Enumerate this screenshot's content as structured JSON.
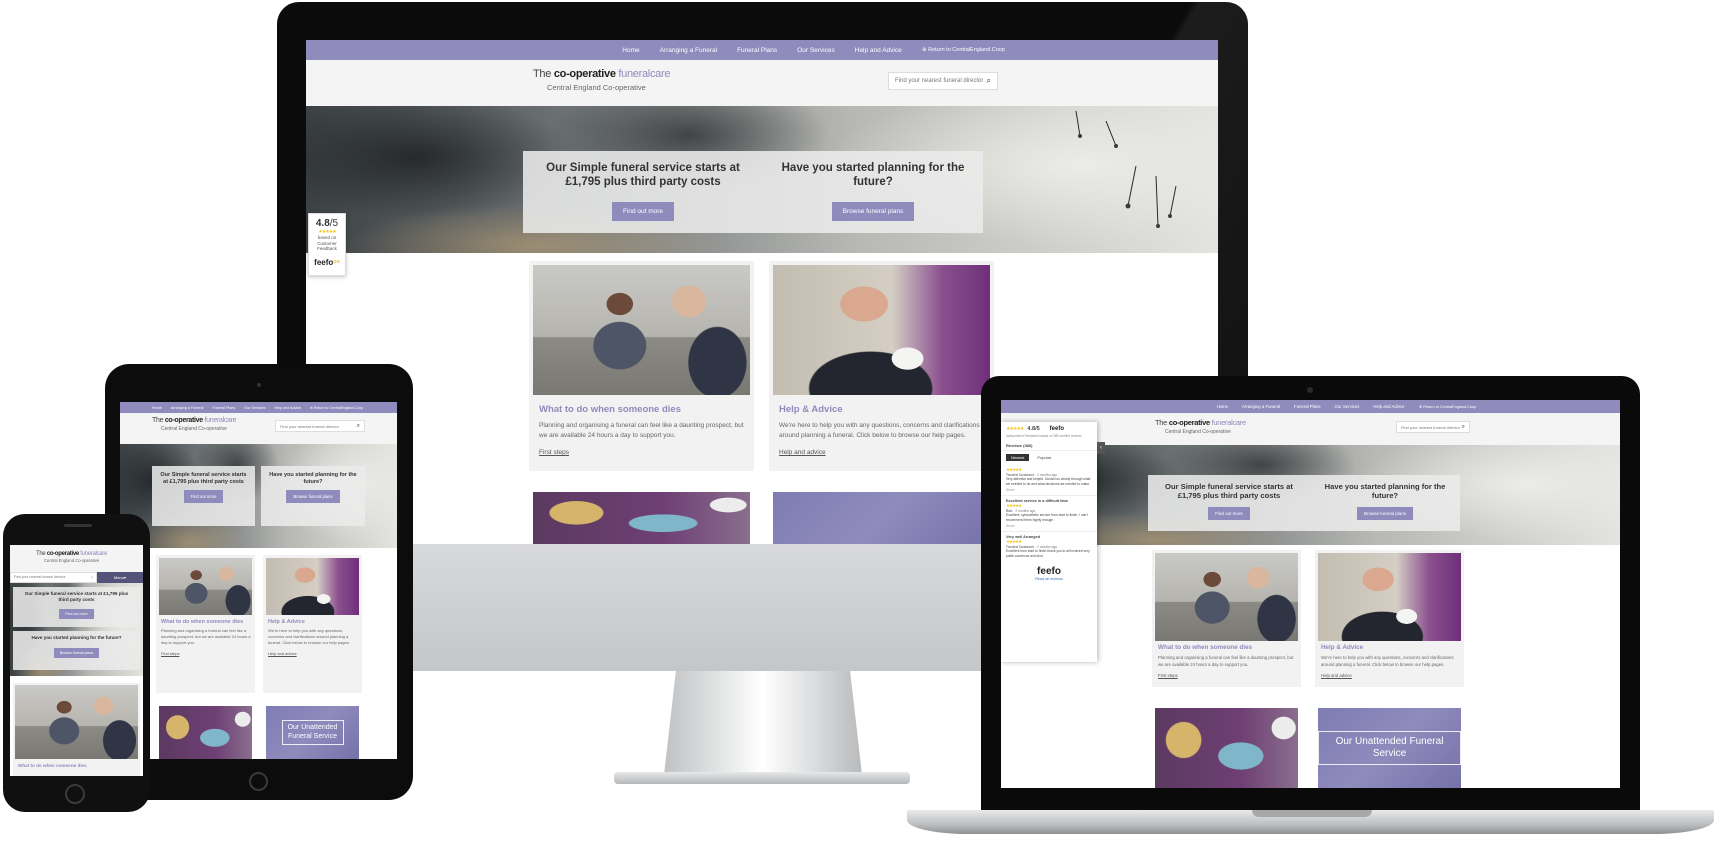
{
  "site": {
    "nav": [
      "Home",
      "Arranging a Funeral",
      "Funeral Plans",
      "Our Services",
      "Help and Advice"
    ],
    "return_prefix": "Return to",
    "return_link": "CentralEngland.Coop",
    "logo": {
      "the": "The",
      "coop": "co-operative",
      "brand": "funeralcare",
      "sub": "Central England Co-operative"
    },
    "search_placeholder": "Find your nearest funeral director",
    "menu_label": "Menu",
    "hero": {
      "left_title": "Our Simple funeral service starts at £1,795 plus third party costs",
      "left_button": "Find out more",
      "right_title": "Have you started planning for the future?",
      "right_button": "Browse funeral plans"
    },
    "cards": [
      {
        "title": "What to do when someone dies",
        "text": "Planning and organising a funeral can feel like a daunting prospect, but we are available 24 hours a day to support you.",
        "link": "First steps"
      },
      {
        "title": "Help & Advice",
        "text": "We're here to help you with any questions, concerns and clarifications around planning a funeral. Click below to browse our help pages.",
        "link": "Help and advice"
      }
    ],
    "unattended": "Our Unattended Funeral Service"
  },
  "feefo_badge": {
    "score": "4.8",
    "out_of": "/5",
    "stars": "★★★★★",
    "line1": "based on",
    "line2": "Customer",
    "line3": "Feedback",
    "logo": "feefo"
  },
  "feefo_panel": {
    "score": "4.8/5",
    "summary": "Independent Feedback based on 380 verified reviews",
    "reviews_label": "Reviews (380)",
    "tab_newest": "Newest",
    "tab_popular": "Popular",
    "reviews": [
      {
        "title": "",
        "author": "Trusted Customer",
        "date": "2 months ago",
        "text": "Very attentive and helpful. Guided us clearly through what we needed to do and what decisions we needed to make."
      },
      {
        "title": "Excellent service in a difficult time",
        "author": "Rob",
        "date": "2 months ago",
        "text": "Excellent, sympathetic service from start to finish. I can't recommend them highly enough."
      },
      {
        "title": "Very well Arranged",
        "author": "Trusted Customer",
        "date": "2 months ago",
        "text": "Excellent from start to finish thank you to all involved very polite courteous and kind."
      }
    ],
    "share": "Share",
    "read_all": "Read all reviews",
    "logo": "feefo"
  },
  "colors": {
    "brand_purple": "#8f8bbd",
    "star_yellow": "#f3c419",
    "device_black": "#0b0b0b"
  },
  "icons": {
    "search": "search-icon",
    "return": "globe-icon",
    "menu": "chevron-down-icon"
  }
}
